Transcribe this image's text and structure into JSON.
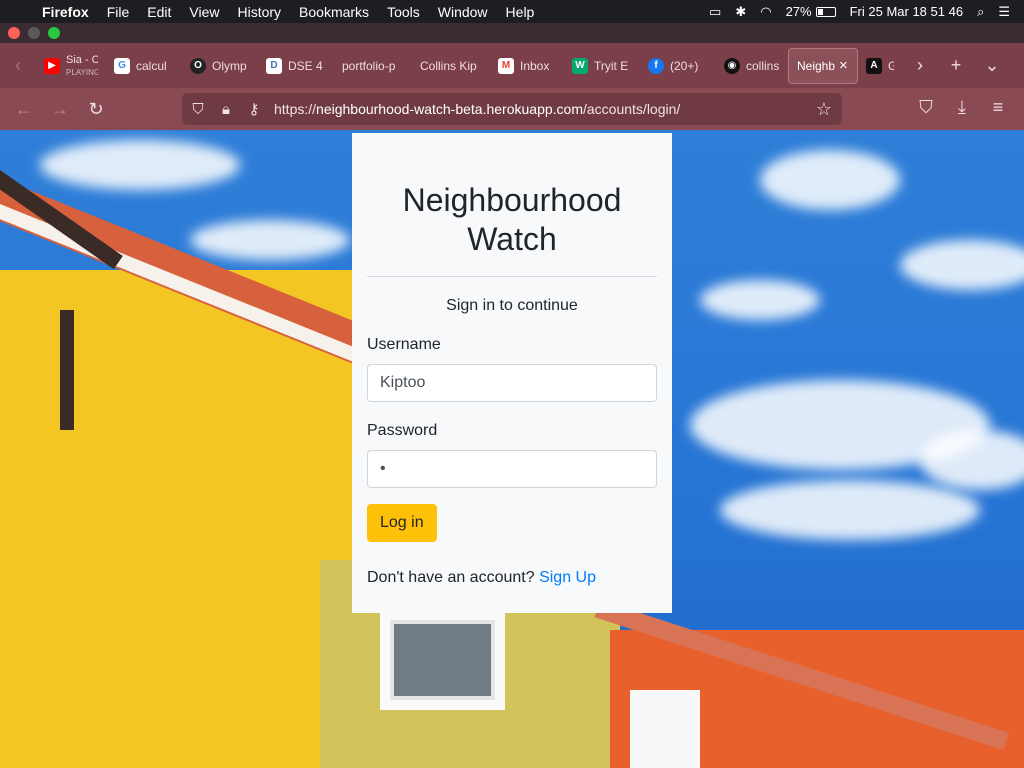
{
  "menubar": {
    "apple": "",
    "items": [
      "Firefox",
      "File",
      "Edit",
      "View",
      "History",
      "Bookmarks",
      "Tools",
      "Window",
      "Help"
    ],
    "battery": "27%",
    "clock": "Fri 25 Mar  18 51 46"
  },
  "tabs": [
    {
      "label": "Sia - C",
      "sub": "PLAYING",
      "icon": "youtube-icon",
      "color": "#ff0000",
      "glyph": "▶"
    },
    {
      "label": "calcul",
      "icon": "google-icon",
      "color": "#ffffff",
      "glyph": "G"
    },
    {
      "label": "Olymp",
      "icon": "olympus-icon",
      "color": "#222222",
      "glyph": "O"
    },
    {
      "label": "DSE 4",
      "icon": "document-icon",
      "color": "#4a6fb5",
      "glyph": "D"
    },
    {
      "label": "portfolio-p",
      "icon": "",
      "color": "",
      "glyph": ""
    },
    {
      "label": "Collins Kip",
      "icon": "",
      "color": "",
      "glyph": ""
    },
    {
      "label": "Inbox",
      "icon": "gmail-icon",
      "color": "#ea4335",
      "glyph": "M"
    },
    {
      "label": "Tryit E",
      "icon": "w3schools-icon",
      "color": "#04aa6d",
      "glyph": "W"
    },
    {
      "label": "(20+) ",
      "icon": "facebook-icon",
      "color": "#1877f2",
      "glyph": "f"
    },
    {
      "label": "collins",
      "icon": "github-icon",
      "color": "#111111",
      "glyph": "◉"
    },
    {
      "label": "Neighb",
      "icon": "",
      "color": "",
      "glyph": "",
      "active": true,
      "close": "×"
    },
    {
      "label": "Gi",
      "icon": "angular-icon",
      "color": "#111111",
      "glyph": "A"
    }
  ],
  "url": {
    "scheme": "https://",
    "host": "neighbourhood-watch-beta.herokuapp.com",
    "path": "/accounts/login/"
  },
  "login": {
    "title": "Neighbourhood Watch",
    "subtitle": "Sign in to continue",
    "username_label": "Username",
    "username_value": "Kiptoo",
    "password_label": "Password",
    "password_value": "•",
    "login_button": "Log in",
    "signup_prompt": "Don't have an account?",
    "signup_link": "Sign Up"
  },
  "colors": {
    "tabbar": "#7a3f48",
    "navbar": "#8a4a53",
    "card": "#f8f9fa",
    "button": "#ffc107",
    "link": "#007bff"
  }
}
